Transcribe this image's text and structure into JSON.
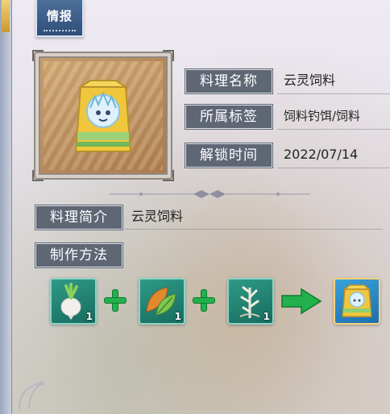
{
  "tab": {
    "label": "情报"
  },
  "item": {
    "icon": "feed-bag-icon"
  },
  "fields": {
    "name_label": "料理名称",
    "name_value": "云灵饲料",
    "tags_label": "所属标签",
    "tags_value": "饲料钓饵/饲料",
    "unlock_label": "解锁时间",
    "unlock_value": "2022/07/14"
  },
  "intro": {
    "label": "料理简介",
    "value": "云灵饲料"
  },
  "recipe": {
    "label": "制作方法",
    "ingredients": [
      {
        "icon": "turnip-icon",
        "count": "1"
      },
      {
        "icon": "leaf-icon",
        "count": "1"
      },
      {
        "icon": "herb-icon",
        "count": "1"
      }
    ],
    "result": {
      "icon": "feed-bag-icon"
    }
  },
  "colors": {
    "label_bg": "#5f6674",
    "slot_teal": "#2f9a87",
    "slot_blue": "#3aa0d8",
    "plus_green": "#22b14c"
  }
}
